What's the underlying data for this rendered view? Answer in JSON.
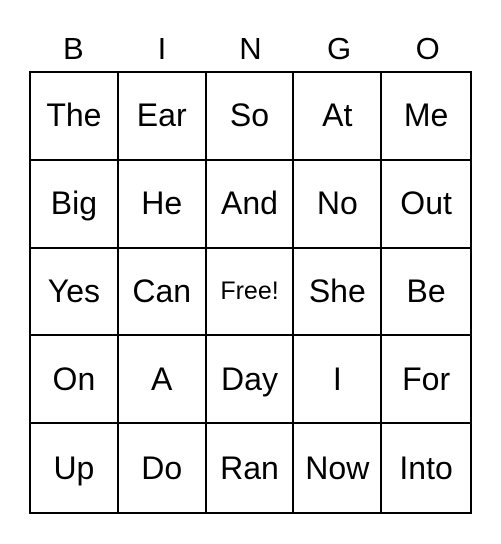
{
  "header": [
    "B",
    "I",
    "N",
    "G",
    "O"
  ],
  "rows": [
    [
      "The",
      "Ear",
      "So",
      "At",
      "Me"
    ],
    [
      "Big",
      "He",
      "And",
      "No",
      "Out"
    ],
    [
      "Yes",
      "Can",
      "Free!",
      "She",
      "Be"
    ],
    [
      "On",
      "A",
      "Day",
      "I",
      "For"
    ],
    [
      "Up",
      "Do",
      "Ran",
      "Now",
      "Into"
    ]
  ],
  "free_cell": {
    "row": 2,
    "col": 2
  }
}
